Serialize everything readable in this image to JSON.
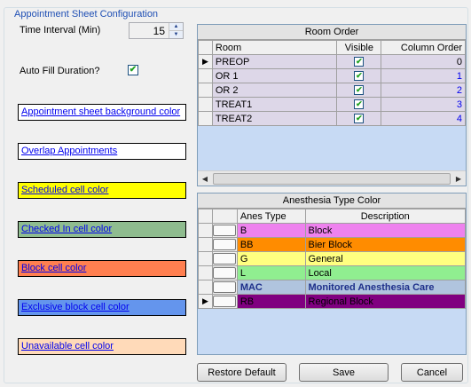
{
  "group_title": "Appointment Sheet Configuration",
  "time_interval": {
    "label": "Time Interval (Min)",
    "value": "15"
  },
  "auto_fill": {
    "label": "Auto Fill Duration?",
    "checked": true
  },
  "color_links": [
    {
      "label": "Appointment sheet background color",
      "bg": "#ffffff"
    },
    {
      "label": "Overlap Appointments",
      "bg": "#ffffff"
    },
    {
      "label": "Scheduled cell color",
      "bg": "#ffff00"
    },
    {
      "label": "Checked In cell color",
      "bg": "#8fbc8f"
    },
    {
      "label": "Block cell color",
      "bg": "#ff7f50"
    },
    {
      "label": "Exclusive block cell color",
      "bg": "#6495ed"
    },
    {
      "label": "Unavailable cell color",
      "bg": "#ffdab9"
    }
  ],
  "room_order": {
    "caption": "Room Order",
    "columns": [
      "Room",
      "Visible",
      "Column Order"
    ],
    "rows": [
      {
        "room": "PREOP",
        "visible": true,
        "order": "0",
        "current": true
      },
      {
        "room": "OR 1",
        "visible": true,
        "order": "1"
      },
      {
        "room": "OR 2",
        "visible": true,
        "order": "2"
      },
      {
        "room": "TREAT1",
        "visible": true,
        "order": "3"
      },
      {
        "room": "TREAT2",
        "visible": true,
        "order": "4"
      }
    ],
    "row_bg": "#ddd7e8"
  },
  "anesthesia": {
    "caption": "Anesthesia Type Color",
    "columns": [
      "Anes Type",
      "Description"
    ],
    "rows": [
      {
        "type": "B",
        "desc": "Block",
        "bg": "#ee82ee",
        "fg": "#000000"
      },
      {
        "type": "BB",
        "desc": "Bier Block",
        "bg": "#ff8c00",
        "fg": "#000000"
      },
      {
        "type": "G",
        "desc": "General",
        "bg": "#ffff80",
        "fg": "#000000"
      },
      {
        "type": "L",
        "desc": "Local",
        "bg": "#90ee90",
        "fg": "#000000"
      },
      {
        "type": "MAC",
        "desc": "Monitored Anesthesia Care",
        "bg": "#b0c4de",
        "fg": "#1e2f8a",
        "bold": true
      },
      {
        "type": "RB",
        "desc": "Regional Block",
        "bg": "#800080",
        "fg": "#000000",
        "current": true
      }
    ]
  },
  "buttons": {
    "restore": "Restore Default",
    "save": "Save",
    "cancel": "Cancel"
  },
  "icons": {
    "checkmark": "checkmark-icon",
    "row_pointer": "row-pointer-icon",
    "spin_up": "spin-up-icon",
    "spin_down": "spin-down-icon"
  }
}
